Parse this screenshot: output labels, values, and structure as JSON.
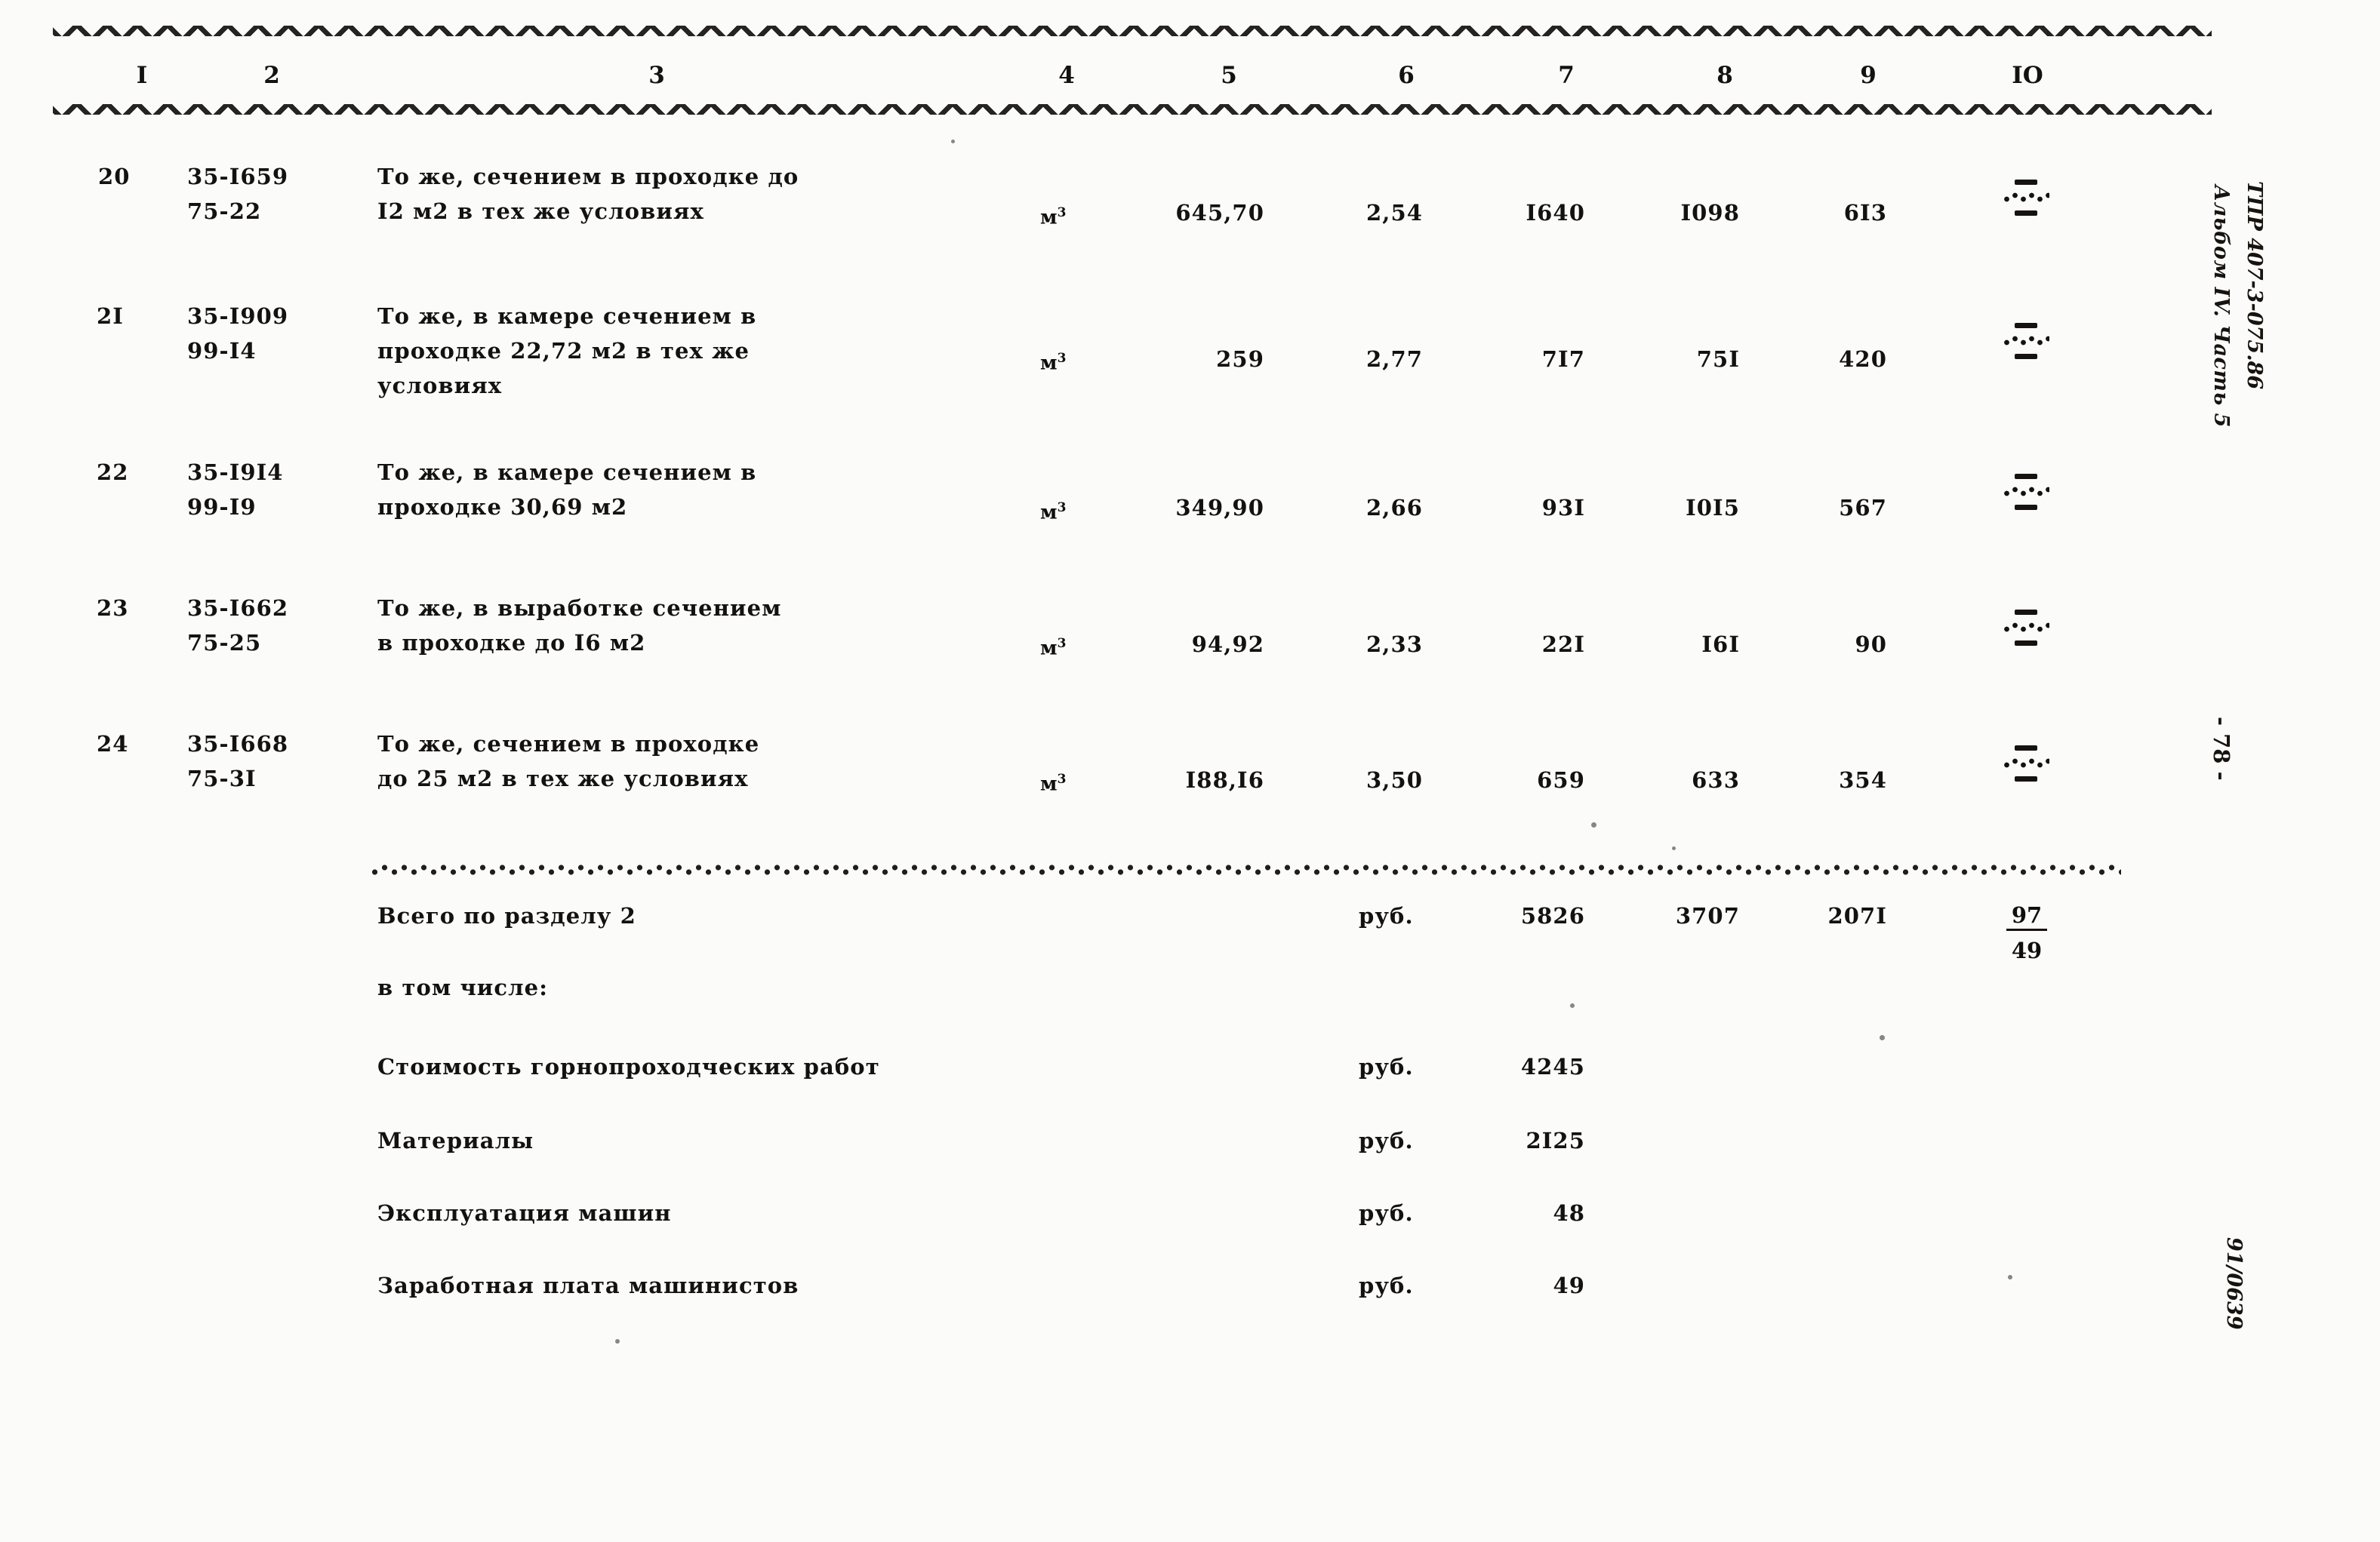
{
  "document": {
    "type": "scanned-estimate-table",
    "language": "ru"
  },
  "table": {
    "column_headers": [
      "I",
      "2",
      "3",
      "4",
      "5",
      "6",
      "7",
      "8",
      "9",
      "IO"
    ],
    "rows": [
      {
        "no": "20",
        "code_line1": "35-I659",
        "code_line2": "75-22",
        "description_line1": "То же, сечением в проходке до",
        "description_line2": "I2 м2 в тех же условиях",
        "description_line3": "",
        "unit": "м",
        "unit_sup": "3",
        "qty": "645,70",
        "price": "2,54",
        "col7": "I640",
        "col8": "I098",
        "col9": "6I3",
        "col10": "—/—"
      },
      {
        "no": "2I",
        "code_line1": "35-I909",
        "code_line2": "99-I4",
        "description_line1": "То же, в камере сечением в",
        "description_line2": "проходке 22,72 м2 в тех же",
        "description_line3": "условиях",
        "unit": "м",
        "unit_sup": "3",
        "qty": "259",
        "price": "2,77",
        "col7": "7I7",
        "col8": "75I",
        "col9": "420",
        "col10": "—/—"
      },
      {
        "no": "22",
        "code_line1": "35-I9I4",
        "code_line2": "99-I9",
        "description_line1": "То же, в камере сечением в",
        "description_line2": "проходке 30,69 м2",
        "description_line3": "",
        "unit": "м",
        "unit_sup": "3",
        "qty": "349,90",
        "price": "2,66",
        "col7": "93I",
        "col8": "I0I5",
        "col9": "567",
        "col10": "—/—"
      },
      {
        "no": "23",
        "code_line1": "35-I662",
        "code_line2": "75-25",
        "description_line1": "То же, в выработке сечением",
        "description_line2": "в проходке до I6 м2",
        "description_line3": "",
        "unit": "м",
        "unit_sup": "3",
        "qty": "94,92",
        "price": "2,33",
        "col7": "22I",
        "col8": "I6I",
        "col9": "90",
        "col10": "—/—"
      },
      {
        "no": "24",
        "code_line1": "35-I668",
        "code_line2": "75-3I",
        "description_line1": "То же, сечением в проходке",
        "description_line2": "до 25 м2 в тех же условиях",
        "description_line3": "",
        "unit": "м",
        "unit_sup": "3",
        "qty": "I88,I6",
        "price": "3,50",
        "col7": "659",
        "col8": "633",
        "col9": "354",
        "col10": "—/—"
      }
    ]
  },
  "summary": {
    "total_label": "Всего по разделу 2",
    "total_unit": "руб.",
    "total_col7": "5826",
    "total_col8": "3707",
    "total_col9": "207I",
    "total_col10_numerator": "97",
    "total_col10_denominator": "49",
    "including_label": "в том числе:",
    "breakdown": [
      {
        "label": "Стоимость горнопроходческих работ",
        "unit": "руб.",
        "value": "4245"
      },
      {
        "label": "Материалы",
        "unit": "руб.",
        "value": "2I25"
      },
      {
        "label": "Эксплуатация машин",
        "unit": "руб.",
        "value": "48"
      },
      {
        "label": "Заработная плата машинистов",
        "unit": "руб.",
        "value": "49"
      }
    ]
  },
  "margin": {
    "doc_code": "ТПР 407-3-075.86",
    "album": "Альбом IV. Часть 5",
    "page_number": "- 78 -",
    "bottom_code": "91/0639"
  }
}
